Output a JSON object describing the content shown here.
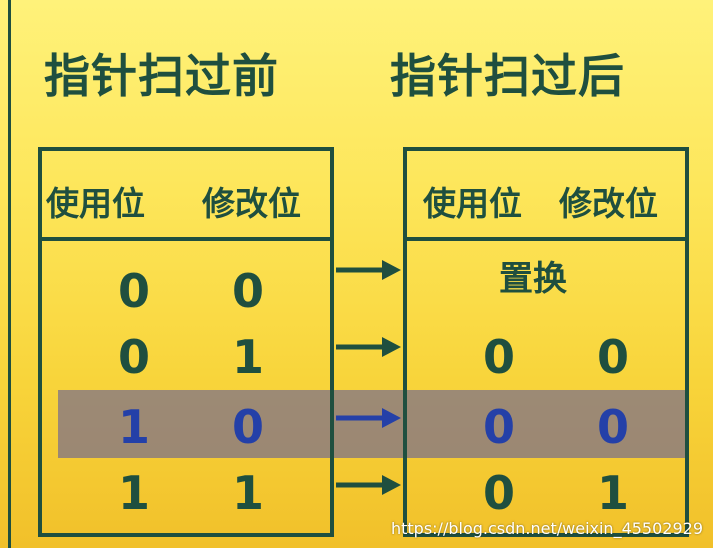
{
  "titles": {
    "before": "指针扫过前",
    "after": "指针扫过后"
  },
  "table_before": {
    "headers": [
      "使用位",
      "修改位"
    ],
    "rows": [
      [
        "0",
        "0"
      ],
      [
        "0",
        "1"
      ],
      [
        "1",
        "0"
      ],
      [
        "1",
        "1"
      ]
    ]
  },
  "table_after": {
    "headers": [
      "使用位",
      "修改位"
    ],
    "replace_label": "置换",
    "rows": [
      [
        "0",
        "0"
      ],
      [
        "0",
        "0"
      ],
      [
        "0",
        "1"
      ]
    ]
  },
  "watermark": "https://blog.csdn.net/weixin_45502929",
  "colors": {
    "text": "#1f4f3f",
    "highlight_text": "#2440a8",
    "highlight_band": "#786e8c",
    "background_top": "#fff27a",
    "background_bottom": "#f1c02a"
  }
}
